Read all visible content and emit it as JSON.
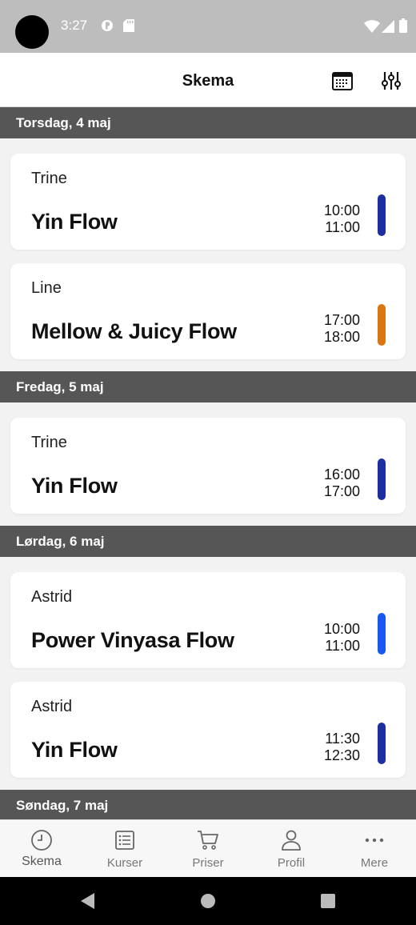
{
  "status_bar": {
    "time": "3:27",
    "icons": [
      "data-saver-icon",
      "sd-card-icon",
      "wifi-icon",
      "signal-icon",
      "battery-icon"
    ]
  },
  "app_bar": {
    "title": "Skema",
    "actions": [
      "calendar-icon",
      "filter-sliders-icon"
    ]
  },
  "schedule": [
    {
      "day": "Torsdag, 4 maj",
      "classes": [
        {
          "teacher": "Trine",
          "name": "Yin Flow",
          "start": "10:00",
          "end": "11:00",
          "color": "#1e2ea0"
        },
        {
          "teacher": "Line",
          "name": "Mellow & Juicy Flow",
          "start": "17:00",
          "end": "18:00",
          "color": "#d97612"
        }
      ]
    },
    {
      "day": "Fredag, 5 maj",
      "classes": [
        {
          "teacher": "Trine",
          "name": "Yin Flow",
          "start": "16:00",
          "end": "17:00",
          "color": "#1e2ea0"
        }
      ]
    },
    {
      "day": "Lørdag, 6 maj",
      "classes": [
        {
          "teacher": "Astrid",
          "name": "Power Vinyasa Flow",
          "start": "10:00",
          "end": "11:00",
          "color": "#1a56f0"
        },
        {
          "teacher": "Astrid",
          "name": "Yin Flow",
          "start": "11:30",
          "end": "12:30",
          "color": "#1e2ea0"
        }
      ]
    },
    {
      "day": "Søndag, 7 maj",
      "classes": []
    }
  ],
  "tab_bar": {
    "active": 0,
    "tabs": [
      {
        "label": "Skema",
        "icon": "clock-icon"
      },
      {
        "label": "Kurser",
        "icon": "list-icon"
      },
      {
        "label": "Priser",
        "icon": "cart-icon"
      },
      {
        "label": "Profil",
        "icon": "person-icon"
      },
      {
        "label": "Mere",
        "icon": "more-dots-icon"
      }
    ]
  },
  "colors": {
    "day_header_bg": "#565656",
    "status_bar_bg": "#bdbdbd",
    "page_bg": "#f2f2f2"
  }
}
